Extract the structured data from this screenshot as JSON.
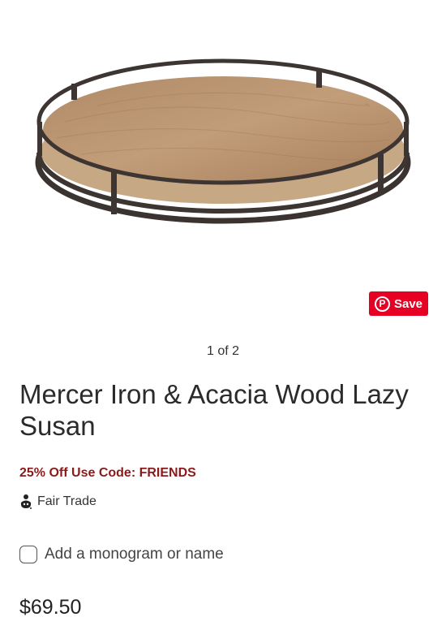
{
  "product": {
    "image_alt": "Mercer Iron & Acacia Wood Lazy Susan tray",
    "pager": "1 of 2",
    "title": "Mercer Iron & Acacia Wood Lazy Susan",
    "promo": "25% Off Use Code: FRIENDS",
    "fair_trade_label": "Fair Trade",
    "monogram_label": "Add a monogram or name",
    "monogram_checked": false,
    "price": "$69.50"
  },
  "pinterest": {
    "save_label": "Save",
    "icon": "pinterest-icon",
    "color": "#e60023"
  },
  "colors": {
    "promo": "#8b1a1a"
  },
  "icons": {
    "fair_trade": "fair-trade-icon"
  }
}
